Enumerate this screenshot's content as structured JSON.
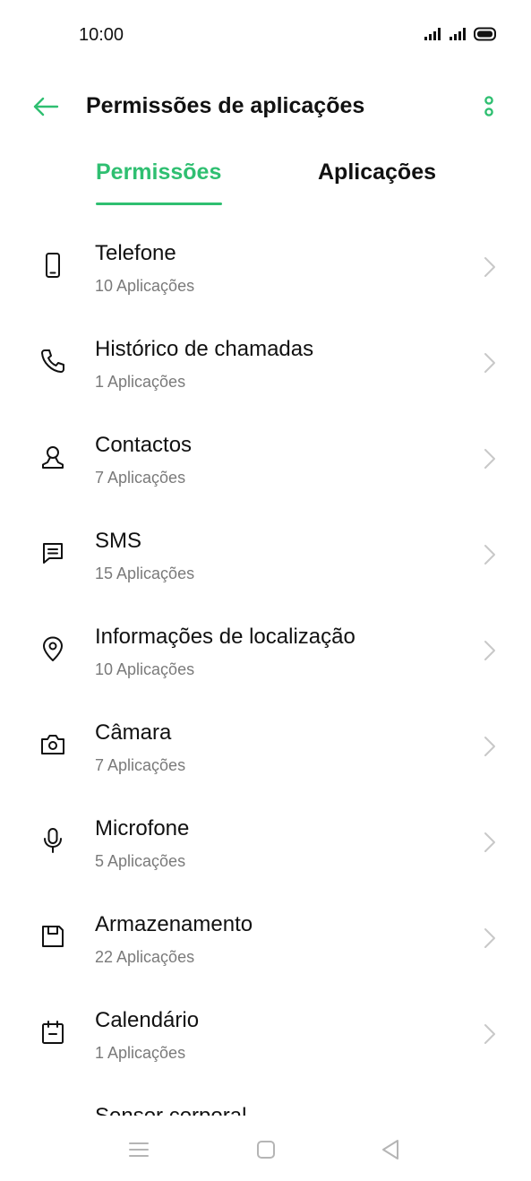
{
  "status": {
    "time": "10:00"
  },
  "header": {
    "title": "Permissões de aplicações"
  },
  "tabs": [
    {
      "label": "Permissões",
      "active": true
    },
    {
      "label": "Aplicações",
      "active": false
    }
  ],
  "permissions": [
    {
      "label": "Telefone",
      "count": "10 Aplicações",
      "icon": "phone-device-icon"
    },
    {
      "label": "Histórico de chamadas",
      "count": "1 Aplicações",
      "icon": "call-icon"
    },
    {
      "label": "Contactos",
      "count": "7 Aplicações",
      "icon": "contacts-icon"
    },
    {
      "label": "SMS",
      "count": "15 Aplicações",
      "icon": "message-icon"
    },
    {
      "label": "Informações de localização",
      "count": "10 Aplicações",
      "icon": "location-icon"
    },
    {
      "label": "Câmara",
      "count": "7 Aplicações",
      "icon": "camera-icon"
    },
    {
      "label": "Microfone",
      "count": "5 Aplicações",
      "icon": "microphone-icon"
    },
    {
      "label": "Armazenamento",
      "count": "22 Aplicações",
      "icon": "storage-icon"
    },
    {
      "label": "Calendário",
      "count": "1 Aplicações",
      "icon": "calendar-icon"
    },
    {
      "label": "Sensor corporal",
      "count": "",
      "icon": "body-sensor-icon"
    }
  ],
  "colors": {
    "accent": "#2fbf71",
    "text": "#111111",
    "secondary": "#7a7a7a",
    "chevron": "#c8c8c8"
  }
}
